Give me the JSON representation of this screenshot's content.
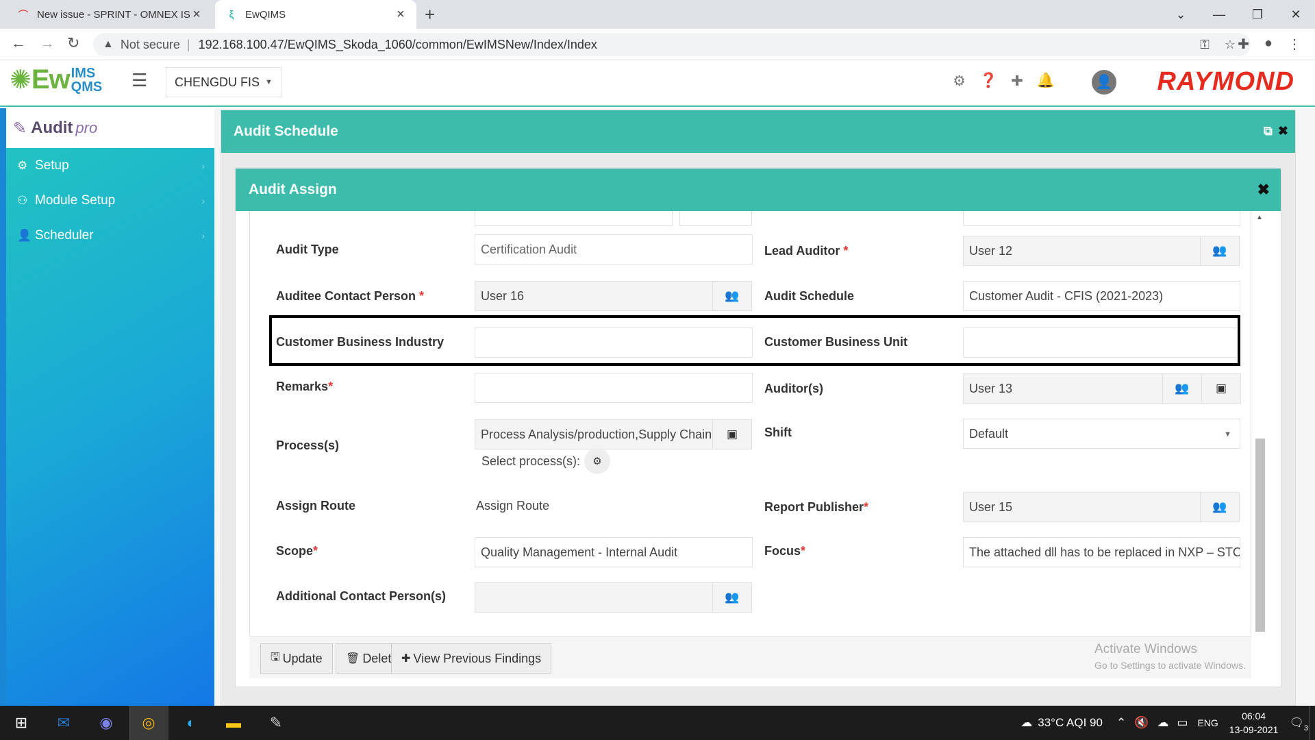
{
  "browser": {
    "tabs": [
      {
        "title": "New issue - SPRINT - OMNEX ISS"
      },
      {
        "title": "EwQIMS"
      }
    ],
    "address": {
      "security": "Not secure",
      "url": "192.168.100.47/EwQIMS_Skoda_1060/common/EwIMSNew/Index/Index"
    }
  },
  "header": {
    "logo_main": "Ew",
    "logo_top": "IMS",
    "logo_bottom": "QMS",
    "site": "CHENGDU FIS",
    "brand": "RAYMOND"
  },
  "sidebar": {
    "logo_text": "Audit",
    "logo_suffix": "pro",
    "items": [
      {
        "label": "Setup",
        "icon": "gear-icon"
      },
      {
        "label": "Module Setup",
        "icon": "users-cog-icon"
      },
      {
        "label": "Scheduler",
        "icon": "user-clock-icon"
      }
    ]
  },
  "outer_panel": {
    "title": "Audit Schedule"
  },
  "modal": {
    "title": "Audit Assign",
    "fields": {
      "audit_type": {
        "label": "Audit Type",
        "value": "Certification Audit"
      },
      "lead_auditor": {
        "label": "Lead Auditor",
        "value": "User 12"
      },
      "auditee_contact": {
        "label": "Auditee Contact Person",
        "value": "User 16"
      },
      "audit_schedule": {
        "label": "Audit Schedule",
        "value": "Customer Audit - CFIS (2021-2023)"
      },
      "cust_industry": {
        "label": "Customer Business Industry",
        "value": ""
      },
      "cust_unit": {
        "label": "Customer Business Unit",
        "value": ""
      },
      "remarks": {
        "label": "Remarks",
        "value": ""
      },
      "auditors": {
        "label": "Auditor(s)",
        "value": "User 13"
      },
      "processes": {
        "label": "Process(s)",
        "value": "Process Analysis/production,Supply Chain",
        "select_label": "Select process(s):"
      },
      "shift": {
        "label": "Shift",
        "value": "Default"
      },
      "assign_route": {
        "label": "Assign Route",
        "value": "Assign Route"
      },
      "report_publisher": {
        "label": "Report Publisher",
        "value": "User 15"
      },
      "scope": {
        "label": "Scope",
        "value": "Quality Management - Internal Audit"
      },
      "focus": {
        "label": "Focus",
        "value": "The attached dll has to be replaced in NXP – STC"
      },
      "additional_contacts": {
        "label": "Additional Contact Person(s)",
        "value": ""
      }
    },
    "buttons": {
      "update": "Update",
      "delete": "Delete",
      "view_findings": "View Previous Findings"
    }
  },
  "watermark": {
    "line1": "Activate Windows",
    "line2": "Go to Settings to activate Windows."
  },
  "taskbar": {
    "weather": "33°C  AQI 90",
    "lang": "ENG",
    "time": "06:04",
    "date": "13-09-2021",
    "notifications": "3"
  }
}
